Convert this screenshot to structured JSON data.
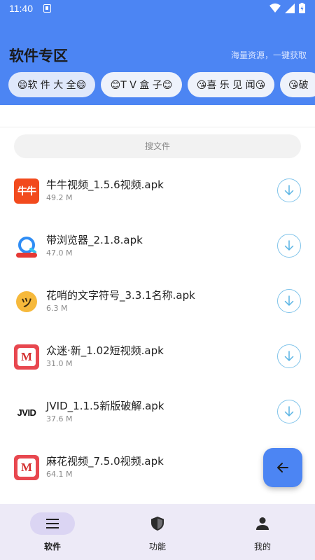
{
  "status_bar": {
    "time": "11:40"
  },
  "header": {
    "title": "软件专区",
    "subtitle": "海量资源，一键获取",
    "tabs": [
      {
        "label": "😄软 件 大 全😄"
      },
      {
        "label": "😊T V 盒 子😊"
      },
      {
        "label": "😘喜 乐 见 闻😘"
      },
      {
        "label": "😘破"
      }
    ]
  },
  "search": {
    "placeholder": "搜文件"
  },
  "files": [
    {
      "name": "牛牛视频_1.5.6视频.apk",
      "size": "49.2 M",
      "icon_text": "牛牛",
      "icon": "niuniu-app-icon"
    },
    {
      "name": "带浏览器_2.1.8.apk",
      "size": "47.0 M",
      "icon": "browser-app-icon"
    },
    {
      "name": "花哨的文字符号_3.3.1名称.apk",
      "size": "6.3 M",
      "icon_text": "ツ",
      "icon": "emoji-app-icon"
    },
    {
      "name": "众迷·新_1.02短视频.apk",
      "size": "31.0 M",
      "icon_text": "M",
      "icon": "m-app-icon"
    },
    {
      "name": "JVID_1.1.5新版破解.apk",
      "size": "37.6 M",
      "icon_text": "JVID",
      "icon": "jvid-app-icon"
    },
    {
      "name": "麻花视频_7.5.0视频.apk",
      "size": "64.1 M",
      "icon_text": "M",
      "icon": "m-app-icon"
    }
  ],
  "bottom_nav": [
    {
      "label": "软件",
      "icon": "menu-icon",
      "active": true
    },
    {
      "label": "功能",
      "icon": "shield-icon",
      "active": false
    },
    {
      "label": "我的",
      "icon": "person-icon",
      "active": false
    }
  ],
  "colors": {
    "primary": "#4c85f3",
    "download_ring": "#7fc3ea",
    "bottom_bar": "#edeaf7"
  }
}
